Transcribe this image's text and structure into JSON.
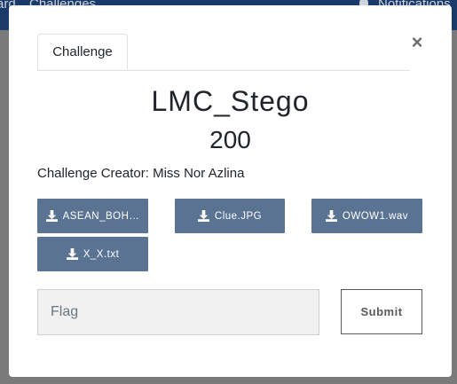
{
  "background_nav": {
    "left_text": "ard",
    "challenges_text": "Challenges",
    "notifications_text": "Notifications"
  },
  "modal": {
    "tab_label": "Challenge",
    "close_symbol": "×",
    "challenge_name": "LMC_Stego",
    "challenge_value": "200",
    "creator_text": "Challenge Creator: Miss Nor Azlina",
    "files": [
      {
        "label": "ASEAN_BOH…",
        "icon": "download-icon"
      },
      {
        "label": "Clue.JPG",
        "icon": "download-icon"
      },
      {
        "label": "OWOW1.wav",
        "icon": "download-icon"
      },
      {
        "label": "X_X.txt",
        "icon": "download-icon"
      }
    ],
    "flag_placeholder": "Flag",
    "submit_label": "Submit"
  },
  "colors": {
    "file_button_bg": "#5b7392",
    "nav_bg": "#1a3a6c",
    "overlay": "#7a7a7a"
  }
}
